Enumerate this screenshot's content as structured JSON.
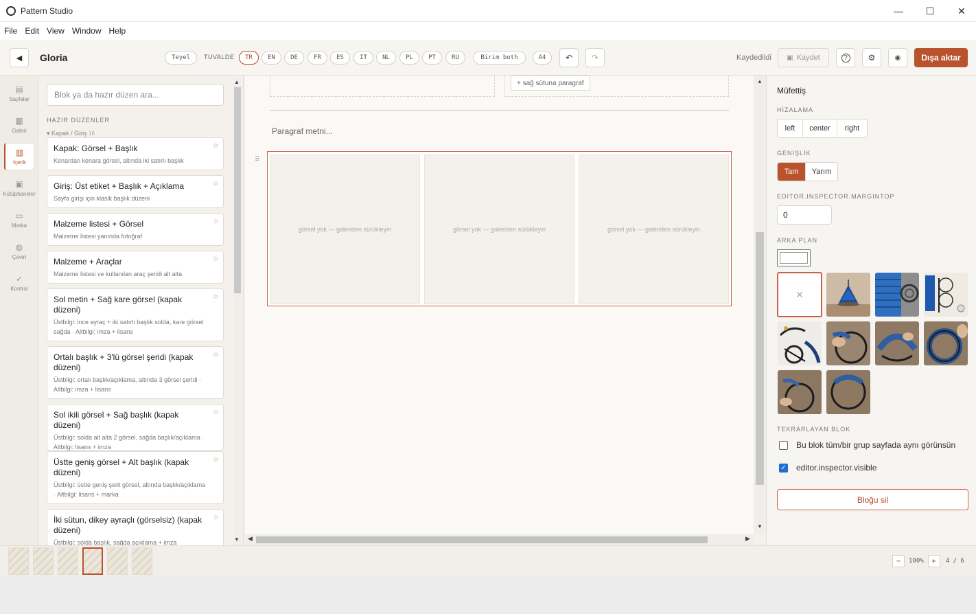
{
  "window": {
    "title": "Pattern Studio",
    "minimize": "—",
    "maximize": "☐",
    "close": "✕"
  },
  "menu": [
    "File",
    "Edit",
    "View",
    "Window",
    "Help"
  ],
  "toolbar": {
    "back": "◀",
    "doc_title": "Gloria",
    "confirm": "Teyel",
    "canvas_label": "TUVALDE",
    "languages": [
      "TR",
      "EN",
      "DE",
      "FR",
      "ES",
      "IT",
      "NL",
      "PL",
      "PT",
      "RU"
    ],
    "active_language": "TR",
    "unit": "Birim both",
    "paper": "A4",
    "undo": "↶",
    "redo": "↷",
    "saved_status": "Kaydedildi",
    "save": "Kaydet",
    "help": "?",
    "settings": "⚙",
    "preview": "◉",
    "export": "Dışa aktar"
  },
  "rail": [
    {
      "label": "Sayfalar",
      "icon": "pages-icon"
    },
    {
      "label": "Galeri",
      "icon": "gallery-icon"
    },
    {
      "label": "İçerik",
      "icon": "content-icon",
      "active": true
    },
    {
      "label": "Kütüphaneler",
      "icon": "library-icon"
    },
    {
      "label": "Marka",
      "icon": "brand-icon"
    },
    {
      "label": "Çeviri",
      "icon": "translate-icon"
    },
    {
      "label": "Kontrol",
      "icon": "check-icon"
    }
  ],
  "layouts": {
    "search_placeholder": "Blok ya da hazır düzen ara...",
    "section": "HAZIR DÜZENLER",
    "group": "Kapak / Giriş",
    "group_count": "16",
    "items": [
      {
        "title": "Kapak: Görsel + Başlık",
        "desc": "Kenardan kenara görsel, altında iki satırlı başlık"
      },
      {
        "title": "Giriş: Üst etiket + Başlık + Açıklama",
        "desc": "Sayfa girişi için klasik başlık düzeni"
      },
      {
        "title": "Malzeme listesi + Görsel",
        "desc": "Malzeme listesi yanında fotoğraf"
      },
      {
        "title": "Malzeme + Araçlar",
        "desc": "Malzeme listesi ve kullanılan araç şeridi alt alta"
      },
      {
        "title": "Sol metin + Sağ kare görsel (kapak düzeni)",
        "desc": "Üstbilgi: ince ayraç + iki satırlı başlık solda, kare görsel sağda · Altbilgi: imza + lisans"
      },
      {
        "title": "Ortalı başlık + 3'lü görsel şeridi (kapak düzeni)",
        "desc": "Üstbilgi: ortalı başlık/açıklama, altında 3 görsel şeridi · Altbilgi: imza + lisans"
      },
      {
        "title": "Sol ikili görsel + Sağ başlık (kapak düzeni)",
        "desc": "Üstbilgi: solda alt alta 2 görsel, sağda başlık/açıklama · Altbilgi: lisans + imza"
      },
      {
        "title": "Üstte geniş görsel + Alt başlık (kapak düzeni)",
        "desc": "Üstbilgi: üstte geniş şerit görsel, altında başlık/açıklama · Altbilgi: lisans + marka"
      },
      {
        "title": "İki sütun, dikey ayraçlı (görselsiz) (kapak düzeni)",
        "desc": "Üstbilgi: solda başlık, sağda açıklama + imza"
      }
    ]
  },
  "canvas": {
    "add_right_para": "+ sağ sütuna paragraf",
    "paragraph_placeholder": "Paragraf metni...",
    "empty_image": "görsel yok — galeriden sürükleyin"
  },
  "inspector": {
    "title": "Müfettiş",
    "align_label": "HİZALAMA",
    "align_options": [
      "left",
      "center",
      "right"
    ],
    "width_label": "GENİŞLİK",
    "width_options": [
      "Tam",
      "Yarım"
    ],
    "width_selected": "Tam",
    "margin_label": "EDITOR.INSPECTOR.MARGINTOP",
    "margin_value": "0",
    "bg_label": "ARKA PLAN",
    "no_image": "✕",
    "repeat_label": "TEKRARLAYAN BLOK",
    "repeat_all_pages": "Bu blok tüm/bir grup sayfada aynı görünsün",
    "repeat_all_checked": false,
    "visible_label": "editor.inspector.visible",
    "visible_checked": true,
    "delete": "Bloğu sil"
  },
  "footer": {
    "page_count": 6,
    "current_page": 4,
    "zoom": "100%",
    "zoom_out": "−",
    "zoom_in": "+",
    "page_indicator": "4 / 6"
  },
  "colors": {
    "accent": "#b9532e",
    "accent_border": "#c9624a",
    "checkbox": "#1f6fd1"
  }
}
